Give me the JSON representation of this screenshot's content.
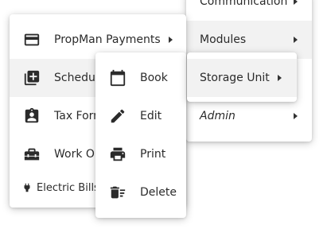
{
  "menu_right": {
    "items": [
      {
        "label": "Communication"
      },
      {
        "label": "Modules"
      },
      {
        "label": "Admin"
      }
    ]
  },
  "storage_submenu": {
    "label": "Storage Unit"
  },
  "menu_main": {
    "items": [
      {
        "label": "PropMan Payments",
        "icon": "credit-card-icon"
      },
      {
        "label": "Schedule",
        "icon": "add-box-icon"
      },
      {
        "label": "Tax Forms",
        "icon": "clipboard-user-icon"
      },
      {
        "label": "Work Orders",
        "icon": "toolbox-icon"
      },
      {
        "label": "Electric Bills",
        "icon": "electric-plug-icon"
      }
    ]
  },
  "actions_menu": {
    "items": [
      {
        "label": "Book",
        "icon": "calendar-icon"
      },
      {
        "label": "Edit",
        "icon": "pencil-icon"
      },
      {
        "label": "Print",
        "icon": "printer-icon"
      },
      {
        "label": "Delete",
        "icon": "delete-sweep-icon"
      }
    ]
  }
}
